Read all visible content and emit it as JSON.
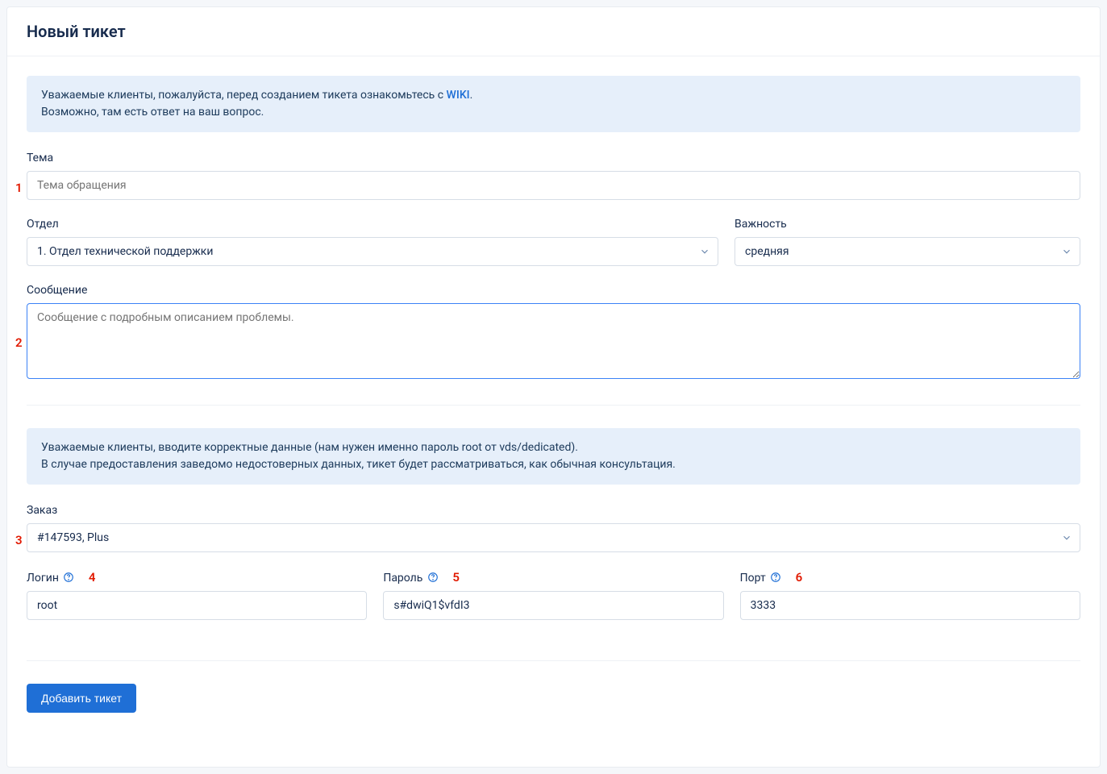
{
  "header": {
    "title": "Новый тикет"
  },
  "info1": {
    "line1_pre": "Уважаемые клиенты, пожалуйста, перед созданием тикета ознакомьтесь с ",
    "wiki": "WIKI",
    "line1_post": ".",
    "line2": "Возможно, там есть ответ на ваш вопрос."
  },
  "form": {
    "subject_label": "Тема",
    "subject_placeholder": "Тема обращения",
    "department_label": "Отдел",
    "department_value": "1. Отдел технической поддержки",
    "priority_label": "Важность",
    "priority_value": "средняя",
    "message_label": "Сообщение",
    "message_placeholder": "Сообщение с подробным описанием проблемы."
  },
  "info2": {
    "line1": "Уважаемые клиенты, вводите корректные данные (нам нужен именно пароль root от vds/dedicated).",
    "line2": "В случае предоставления заведомо недостоверных данных, тикет будет рассматриваться, как обычная консультация."
  },
  "order": {
    "label": "Заказ",
    "value": "#147593, Plus"
  },
  "creds": {
    "login_label": "Логин",
    "login_value": "root",
    "password_label": "Пароль",
    "password_value": "s#dwiQ1$vfdI3",
    "port_label": "Порт",
    "port_value": "3333"
  },
  "submit": {
    "label": "Добавить тикет"
  },
  "annots": {
    "n1": "1",
    "n2": "2",
    "n3": "3",
    "n4": "4",
    "n5": "5",
    "n6": "6"
  }
}
